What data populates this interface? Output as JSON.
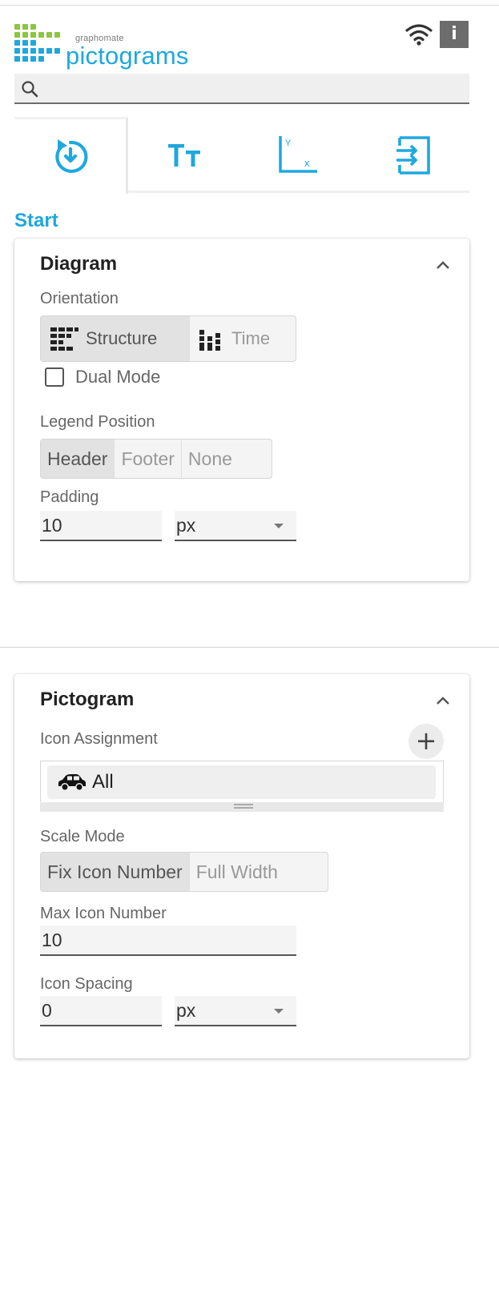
{
  "header": {
    "brand": "graphomate",
    "product": "pictograms",
    "info_label": "i"
  },
  "search": {
    "placeholder": "",
    "value": ""
  },
  "tabs": [
    {
      "name": "start",
      "icon": "start-icon"
    },
    {
      "name": "text",
      "icon": "text-size-icon"
    },
    {
      "name": "axis",
      "icon": "axis-xy-icon"
    },
    {
      "name": "data",
      "icon": "import-icon"
    }
  ],
  "section": {
    "title": "Start"
  },
  "diagram": {
    "title": "Diagram",
    "orientation": {
      "label": "Orientation",
      "options": [
        "Structure",
        "Time"
      ],
      "selected": "Structure"
    },
    "dual_mode": {
      "label": "Dual Mode",
      "checked": false
    },
    "legend_position": {
      "label": "Legend Position",
      "options": [
        "Header",
        "Footer",
        "None"
      ],
      "selected": "Header"
    },
    "padding": {
      "label": "Padding",
      "value": "10",
      "unit": "px"
    }
  },
  "pictogram": {
    "title": "Pictogram",
    "icon_assignment": {
      "label": "Icon Assignment",
      "add_label": "+",
      "items": [
        {
          "icon": "car-icon",
          "label": "All"
        }
      ]
    },
    "scale_mode": {
      "label": "Scale Mode",
      "options": [
        "Fix Icon Number",
        "Full Width"
      ],
      "selected": "Fix Icon Number"
    },
    "max_icon_number": {
      "label": "Max Icon Number",
      "value": "10"
    },
    "icon_spacing": {
      "label": "Icon Spacing",
      "value": "0",
      "unit": "px"
    }
  },
  "colors": {
    "accent": "#1ea8de",
    "logo_green": "#8cc63f",
    "logo_blue": "#1ea8de",
    "info_bg": "#6c6c6c"
  }
}
